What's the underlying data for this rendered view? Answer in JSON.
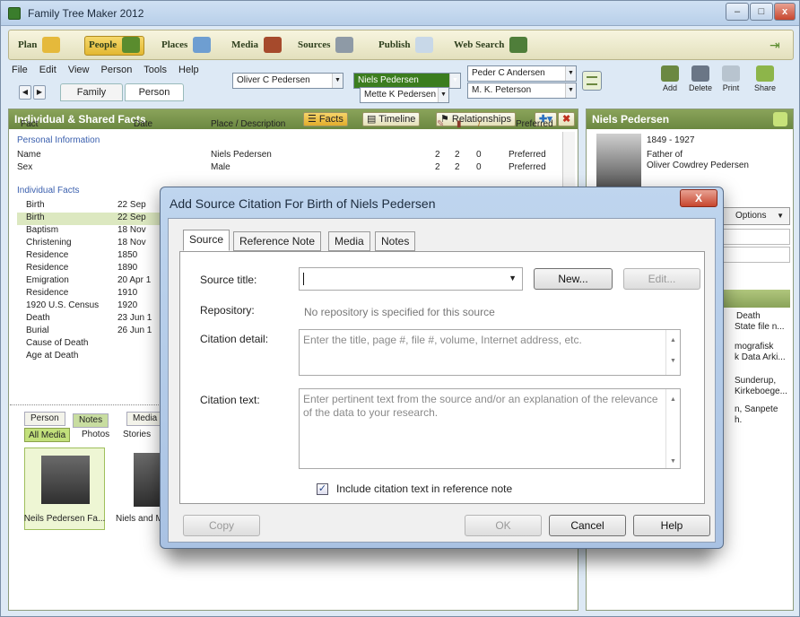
{
  "app": {
    "title": "Family Tree Maker 2012"
  },
  "window_controls": {
    "minimize": "–",
    "maximize": "□",
    "close": "x"
  },
  "nav": [
    {
      "label": "Plan"
    },
    {
      "label": "People"
    },
    {
      "label": "Places"
    },
    {
      "label": "Media"
    },
    {
      "label": "Sources"
    },
    {
      "label": "Publish"
    },
    {
      "label": "Web Search"
    }
  ],
  "menu": [
    "File",
    "Edit",
    "View",
    "Person",
    "Tools",
    "Help"
  ],
  "view_tabs": {
    "family": "Family",
    "person": "Person"
  },
  "family_selectors": {
    "father": "Oliver C Pedersen",
    "selected": "Niels Pedersen",
    "mother": "Mette K Pedersen",
    "spouse_father": "Peder C Andersen",
    "spouse_mother": "M. K. Peterson"
  },
  "toolbar": {
    "add": "Add",
    "delete": "Delete",
    "print": "Print",
    "share": "Share"
  },
  "facts_panel": {
    "title": "Individual & Shared Facts",
    "btn_facts": "Facts",
    "btn_timeline": "Timeline",
    "btn_relationships": "Relationships",
    "columns": {
      "fact": "Fact",
      "date": "Date",
      "place": "Place / Description",
      "preferred": "Preferred"
    },
    "personal_section": "Personal Information",
    "personal_rows": [
      {
        "fact": "Name",
        "place": "Niels Pedersen",
        "c1": "2",
        "c2": "2",
        "c3": "0",
        "pref": "Preferred"
      },
      {
        "fact": "Sex",
        "place": "Male",
        "c1": "2",
        "c2": "2",
        "c3": "0",
        "pref": "Preferred"
      }
    ],
    "individual_section": "Individual Facts",
    "individual_rows": [
      {
        "fact": "Birth",
        "date": "22 Sep"
      },
      {
        "fact": "Birth",
        "date": "22 Sep"
      },
      {
        "fact": "Baptism",
        "date": "18 Nov"
      },
      {
        "fact": "Christening",
        "date": "18 Nov"
      },
      {
        "fact": "Residence",
        "date": "1850"
      },
      {
        "fact": "Residence",
        "date": "1890"
      },
      {
        "fact": "Emigration",
        "date": "20 Apr 1"
      },
      {
        "fact": "Residence",
        "date": "1910"
      },
      {
        "fact": "1920 U.S. Census",
        "date": "1920"
      },
      {
        "fact": "Death",
        "date": "23 Jun 1"
      },
      {
        "fact": "Burial",
        "date": "26 Jun 1"
      },
      {
        "fact": "Cause of Death",
        "date": ""
      },
      {
        "fact": "Age at Death",
        "date": ""
      }
    ]
  },
  "bottom_tabs": {
    "person": "Person",
    "notes": "Notes",
    "media": "Media"
  },
  "media_tabs": {
    "all": "All Media",
    "photos": "Photos",
    "stories": "Stories"
  },
  "thumbs": [
    {
      "caption": "Neils Pedersen Fa..."
    },
    {
      "caption": "Niels and M"
    }
  ],
  "person_panel": {
    "name": "Niels Pedersen",
    "years": "1849 - 1927",
    "relation": "Father of",
    "child": "Oliver Cowdrey Pedersen",
    "options": "Options",
    "sources": [
      {
        "l1": "Death",
        "l2": "State file n..."
      },
      {
        "l1": "mografisk",
        "l2": "k Data Arki..."
      },
      {
        "l1": "Sunderup,",
        "l2": "Kirkeboege..."
      },
      {
        "l1": "n, Sanpete",
        "l2": "h."
      }
    ]
  },
  "dialog": {
    "title": "Add Source Citation For Birth of Niels Pedersen",
    "close": "X",
    "tabs": [
      "Source",
      "Reference Note",
      "Media",
      "Notes"
    ],
    "source_title_label": "Source title:",
    "source_title_value": "",
    "new_button": "New...",
    "edit_button": "Edit...",
    "repository_label": "Repository:",
    "repository_value": "No repository is specified for this source",
    "citation_detail_label": "Citation detail:",
    "citation_detail_placeholder": "Enter the title, page #, file #, volume, Internet address, etc.",
    "citation_text_label": "Citation text:",
    "citation_text_placeholder": "Enter pertinent text from the source and/or an explanation of the relevance of the data to your research.",
    "include_checkbox_label": "Include citation text in reference note",
    "include_checked": true,
    "copy_button": "Copy",
    "ok_button": "OK",
    "cancel_button": "Cancel",
    "help_button": "Help"
  }
}
